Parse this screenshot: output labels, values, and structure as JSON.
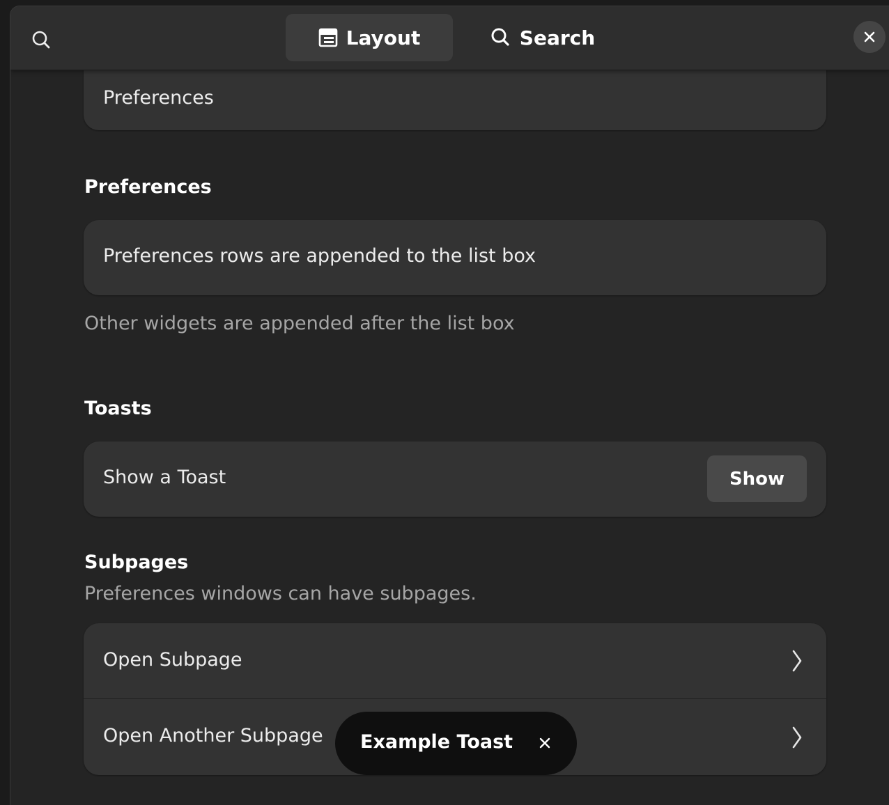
{
  "header": {
    "search_icon": "search-icon",
    "view_switcher": [
      {
        "label": "Layout",
        "icon": "layout-icon",
        "active": true
      },
      {
        "label": "Search",
        "icon": "search-icon",
        "active": false
      }
    ],
    "close_icon": "close-icon"
  },
  "main": {
    "top_card": {
      "label": "Preferences"
    },
    "preferences_group": {
      "title": "Preferences",
      "row_label": "Preferences rows are appended to the list box",
      "footer": "Other widgets are appended after the list box"
    },
    "toasts_group": {
      "title": "Toasts",
      "row_label": "Show a Toast",
      "button_label": "Show"
    },
    "subpages_group": {
      "title": "Subpages",
      "description": "Preferences windows can have subpages.",
      "rows": [
        {
          "label": "Open Subpage",
          "icon": "chevron-right-icon"
        },
        {
          "label": "Open Another Subpage",
          "icon": "chevron-right-icon"
        }
      ]
    }
  },
  "toast": {
    "title": "Example Toast",
    "close_icon": "close-icon"
  },
  "colors": {
    "window_bg": "#242424",
    "card_bg": "#333333",
    "header_bg": "#2e2e2e",
    "toast_bg": "#0f0f0f",
    "dim_text": "#a6a6a6"
  }
}
